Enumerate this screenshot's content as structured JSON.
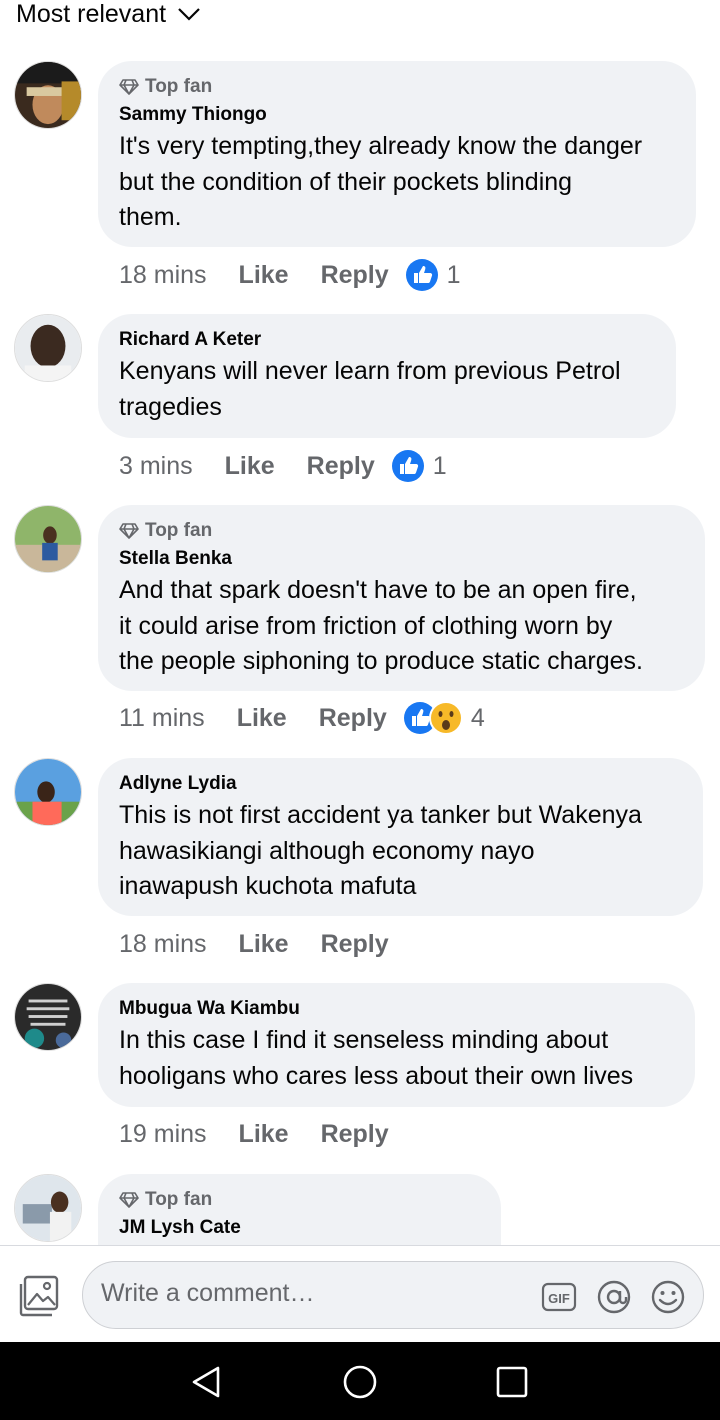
{
  "sort": {
    "label": "Most relevant"
  },
  "comments": [
    {
      "badge": "Top fan",
      "author": "Sammy Thiongo",
      "text": "It's very tempting,they already know the danger\nbut the condition of their pockets blinding\nthem.",
      "time": "18 mins",
      "like": "Like",
      "reply": "Reply",
      "reaction_count": "1"
    },
    {
      "author": "Richard A Keter",
      "text": "Kenyans will never learn from previous Petrol\ntragedies",
      "time": "3 mins",
      "like": "Like",
      "reply": "Reply",
      "reaction_count": "1"
    },
    {
      "badge": "Top fan",
      "author": "Stella Benka",
      "text": "And that spark doesn't have to be an open fire,\nit could arise from friction of clothing worn by\nthe people siphoning to produce static charges.",
      "time": "11 mins",
      "like": "Like",
      "reply": "Reply",
      "reaction_count": "4"
    },
    {
      "author": "Adlyne Lydia",
      "text": "This is not first accident ya tanker but Wakenya\nhawasikiangi although economy nayo\ninawapush kuchota mafuta",
      "time": "18 mins",
      "like": "Like",
      "reply": "Reply"
    },
    {
      "author": "Mbugua Wa Kiambu",
      "text": "In this case I find it senseless minding about\nhooligans who cares less about their own lives",
      "time": "19 mins",
      "like": "Like",
      "reply": "Reply"
    },
    {
      "badge": "Top fan",
      "author": "JM Lysh Cate"
    }
  ],
  "composer": {
    "placeholder": "Write a comment…"
  },
  "icons": {
    "badge": "diamond-icon",
    "reactions": [
      "like-reaction-icon",
      "wow-reaction-icon"
    ],
    "composer": [
      "photo-gallery-icon",
      "gif-icon",
      "mention-icon",
      "emoji-icon"
    ],
    "nav": [
      "back-icon",
      "home-icon",
      "recents-icon"
    ]
  },
  "colors": {
    "bubble": "#f0f2f5",
    "like_blue": "#1877f2",
    "secondary_text": "#65676b",
    "wow_yellow": "#f7b928"
  }
}
